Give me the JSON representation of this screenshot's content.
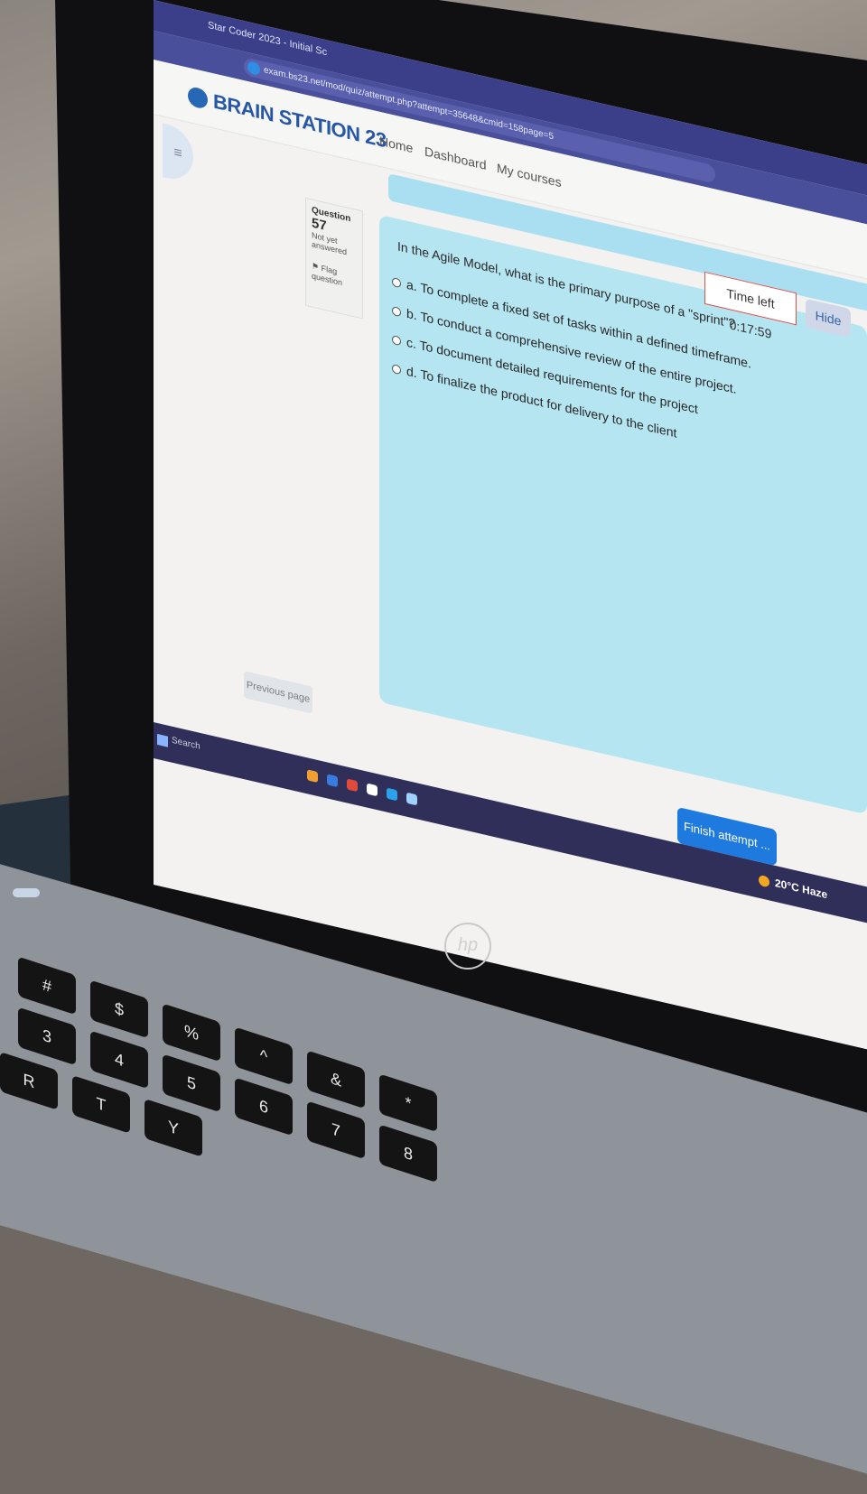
{
  "browser": {
    "tab_title": "Star Coder 2023 - Initial Sc",
    "url": "exam.bs23.net/mod/quiz/attempt.php?attempt=35648&cmid=158page=5"
  },
  "site": {
    "brand": "BRAIN STATION 23",
    "nav": [
      "Home",
      "Dashboard",
      "My courses"
    ]
  },
  "question": {
    "label": "Question",
    "number": "57",
    "status": "Not yet answered",
    "flag_label": "Flag question",
    "text": "In the Agile Model, what is the primary purpose of a \"sprint\"?",
    "options": [
      {
        "letter": "a.",
        "text": "To complete a fixed set of tasks within a defined timeframe."
      },
      {
        "letter": "b.",
        "text": "To conduct a comprehensive review of the entire project."
      },
      {
        "letter": "c.",
        "text": "To document detailed requirements for the project"
      },
      {
        "letter": "d.",
        "text": "To finalize the product for delivery to the client"
      }
    ]
  },
  "timer": {
    "label": "Time left 0:17:59",
    "hide_label": "Hide"
  },
  "buttons": {
    "previous": "Previous page",
    "finish": "Finish attempt ..."
  },
  "taskbar": {
    "search": "Search",
    "weather": "20°C Haze"
  },
  "laptop": {
    "logo": "hp"
  },
  "keyboard": {
    "keys": [
      "#",
      "$",
      "%",
      "^",
      "&",
      "*",
      "3",
      "4",
      "5",
      "6",
      "7",
      "8",
      "R",
      "T",
      "Y"
    ]
  }
}
